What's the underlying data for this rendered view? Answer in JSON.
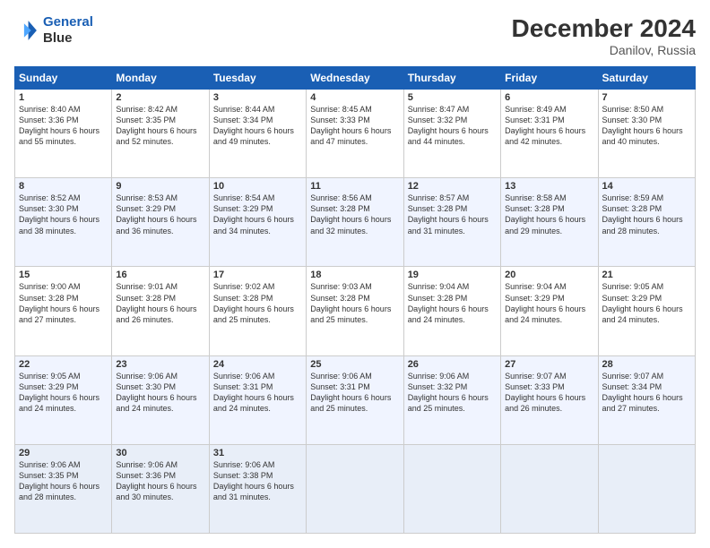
{
  "logo": {
    "line1": "General",
    "line2": "Blue"
  },
  "title": "December 2024",
  "subtitle": "Danilov, Russia",
  "days_header": [
    "Sunday",
    "Monday",
    "Tuesday",
    "Wednesday",
    "Thursday",
    "Friday",
    "Saturday"
  ],
  "weeks": [
    [
      {
        "day": "1",
        "sunrise": "8:40 AM",
        "sunset": "3:36 PM",
        "daylight": "6 hours and 55 minutes."
      },
      {
        "day": "2",
        "sunrise": "8:42 AM",
        "sunset": "3:35 PM",
        "daylight": "6 hours and 52 minutes."
      },
      {
        "day": "3",
        "sunrise": "8:44 AM",
        "sunset": "3:34 PM",
        "daylight": "6 hours and 49 minutes."
      },
      {
        "day": "4",
        "sunrise": "8:45 AM",
        "sunset": "3:33 PM",
        "daylight": "6 hours and 47 minutes."
      },
      {
        "day": "5",
        "sunrise": "8:47 AM",
        "sunset": "3:32 PM",
        "daylight": "6 hours and 44 minutes."
      },
      {
        "day": "6",
        "sunrise": "8:49 AM",
        "sunset": "3:31 PM",
        "daylight": "6 hours and 42 minutes."
      },
      {
        "day": "7",
        "sunrise": "8:50 AM",
        "sunset": "3:30 PM",
        "daylight": "6 hours and 40 minutes."
      }
    ],
    [
      {
        "day": "8",
        "sunrise": "8:52 AM",
        "sunset": "3:30 PM",
        "daylight": "6 hours and 38 minutes."
      },
      {
        "day": "9",
        "sunrise": "8:53 AM",
        "sunset": "3:29 PM",
        "daylight": "6 hours and 36 minutes."
      },
      {
        "day": "10",
        "sunrise": "8:54 AM",
        "sunset": "3:29 PM",
        "daylight": "6 hours and 34 minutes."
      },
      {
        "day": "11",
        "sunrise": "8:56 AM",
        "sunset": "3:28 PM",
        "daylight": "6 hours and 32 minutes."
      },
      {
        "day": "12",
        "sunrise": "8:57 AM",
        "sunset": "3:28 PM",
        "daylight": "6 hours and 31 minutes."
      },
      {
        "day": "13",
        "sunrise": "8:58 AM",
        "sunset": "3:28 PM",
        "daylight": "6 hours and 29 minutes."
      },
      {
        "day": "14",
        "sunrise": "8:59 AM",
        "sunset": "3:28 PM",
        "daylight": "6 hours and 28 minutes."
      }
    ],
    [
      {
        "day": "15",
        "sunrise": "9:00 AM",
        "sunset": "3:28 PM",
        "daylight": "6 hours and 27 minutes."
      },
      {
        "day": "16",
        "sunrise": "9:01 AM",
        "sunset": "3:28 PM",
        "daylight": "6 hours and 26 minutes."
      },
      {
        "day": "17",
        "sunrise": "9:02 AM",
        "sunset": "3:28 PM",
        "daylight": "6 hours and 25 minutes."
      },
      {
        "day": "18",
        "sunrise": "9:03 AM",
        "sunset": "3:28 PM",
        "daylight": "6 hours and 25 minutes."
      },
      {
        "day": "19",
        "sunrise": "9:04 AM",
        "sunset": "3:28 PM",
        "daylight": "6 hours and 24 minutes."
      },
      {
        "day": "20",
        "sunrise": "9:04 AM",
        "sunset": "3:29 PM",
        "daylight": "6 hours and 24 minutes."
      },
      {
        "day": "21",
        "sunrise": "9:05 AM",
        "sunset": "3:29 PM",
        "daylight": "6 hours and 24 minutes."
      }
    ],
    [
      {
        "day": "22",
        "sunrise": "9:05 AM",
        "sunset": "3:29 PM",
        "daylight": "6 hours and 24 minutes."
      },
      {
        "day": "23",
        "sunrise": "9:06 AM",
        "sunset": "3:30 PM",
        "daylight": "6 hours and 24 minutes."
      },
      {
        "day": "24",
        "sunrise": "9:06 AM",
        "sunset": "3:31 PM",
        "daylight": "6 hours and 24 minutes."
      },
      {
        "day": "25",
        "sunrise": "9:06 AM",
        "sunset": "3:31 PM",
        "daylight": "6 hours and 25 minutes."
      },
      {
        "day": "26",
        "sunrise": "9:06 AM",
        "sunset": "3:32 PM",
        "daylight": "6 hours and 25 minutes."
      },
      {
        "day": "27",
        "sunrise": "9:07 AM",
        "sunset": "3:33 PM",
        "daylight": "6 hours and 26 minutes."
      },
      {
        "day": "28",
        "sunrise": "9:07 AM",
        "sunset": "3:34 PM",
        "daylight": "6 hours and 27 minutes."
      }
    ],
    [
      {
        "day": "29",
        "sunrise": "9:06 AM",
        "sunset": "3:35 PM",
        "daylight": "6 hours and 28 minutes."
      },
      {
        "day": "30",
        "sunrise": "9:06 AM",
        "sunset": "3:36 PM",
        "daylight": "6 hours and 30 minutes."
      },
      {
        "day": "31",
        "sunrise": "9:06 AM",
        "sunset": "3:38 PM",
        "daylight": "6 hours and 31 minutes."
      },
      null,
      null,
      null,
      null
    ]
  ],
  "labels": {
    "sunrise": "Sunrise:",
    "sunset": "Sunset:",
    "daylight": "Daylight hours"
  }
}
